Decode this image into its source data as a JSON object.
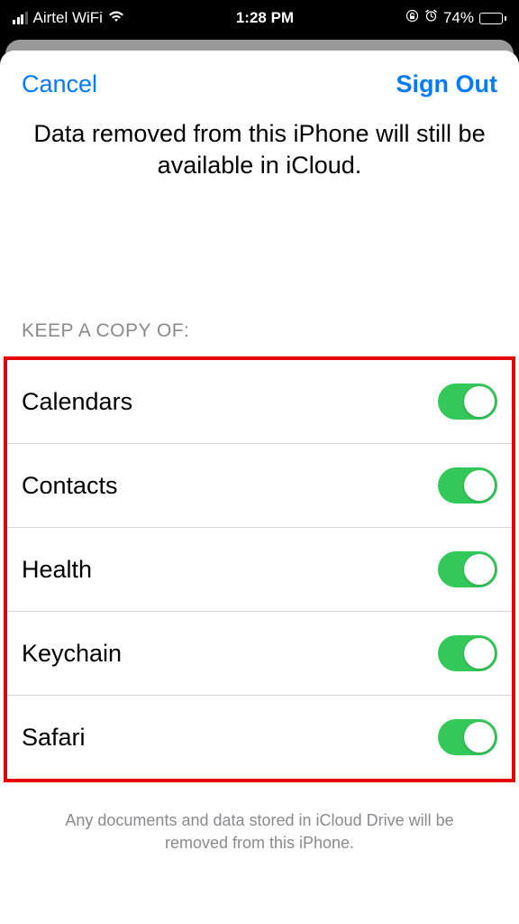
{
  "statusBar": {
    "carrier": "Airtel WiFi",
    "time": "1:28 PM",
    "batteryPercent": "74%"
  },
  "header": {
    "cancel": "Cancel",
    "signOut": "Sign Out"
  },
  "message": "Data removed from this iPhone will still be available in iCloud.",
  "sectionHeader": "KEEP A COPY OF:",
  "items": [
    {
      "label": "Calendars",
      "on": true
    },
    {
      "label": "Contacts",
      "on": true
    },
    {
      "label": "Health",
      "on": true
    },
    {
      "label": "Keychain",
      "on": true
    },
    {
      "label": "Safari",
      "on": true
    }
  ],
  "footer": "Any documents and data stored in iCloud Drive will be removed from this iPhone."
}
